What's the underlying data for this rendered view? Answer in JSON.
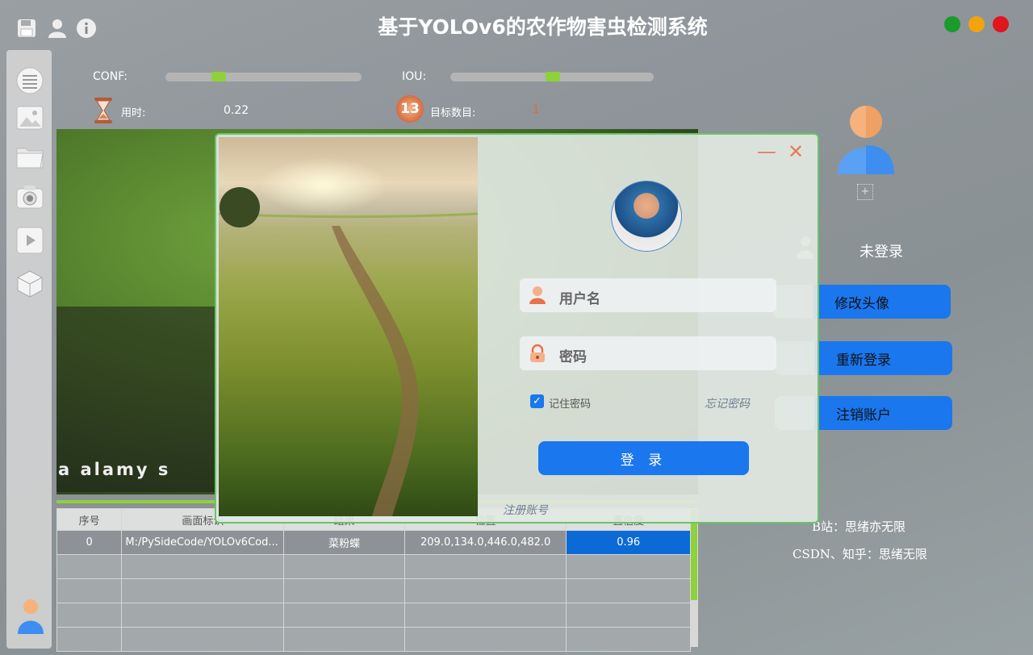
{
  "app": {
    "title": "基于YOLOv6的农作物害虫检测系统",
    "window_controls": [
      "green",
      "yellow",
      "red"
    ]
  },
  "top_icons": [
    "save-icon",
    "user-icon",
    "info-icon"
  ],
  "sidebar": {
    "items": [
      "menu-icon",
      "image-icon",
      "folder-icon",
      "camera-icon",
      "video-icon",
      "model-icon"
    ],
    "bottom": "user-avatar-icon"
  },
  "controls": {
    "conf_label": "CONF:",
    "conf_value": 0.3,
    "iou_label": "IOU:",
    "iou_value": 0.5
  },
  "stats": {
    "time_label": "用时:",
    "time_value": "0.22",
    "count_label": "目标数目:",
    "count_value": "1",
    "count_badge": "13"
  },
  "image": {
    "watermark": "a alamy s"
  },
  "table": {
    "headers": [
      "序号",
      "画面标识",
      "结果",
      "位置",
      "置信度"
    ],
    "rows": [
      [
        "0",
        "M:/PySideCode/YOLOv6Cod...",
        "菜粉蝶",
        "209.0,134.0,446.0,482.0",
        "0.96"
      ],
      [
        "",
        "",
        "",
        "",
        ""
      ],
      [
        "",
        "",
        "",
        "",
        ""
      ],
      [
        "",
        "",
        "",
        "",
        ""
      ],
      [
        "",
        "",
        "",
        "",
        ""
      ]
    ]
  },
  "user_panel": {
    "status": "未登录",
    "add_icon": "+",
    "buttons": [
      "修改头像",
      "重新登录",
      "注销账户"
    ],
    "credits": [
      "B站：思绪亦无限",
      "CSDN、知乎：思绪无限"
    ]
  },
  "login_dialog": {
    "username_placeholder": "用户名",
    "password_placeholder": "密码",
    "remember_label": "记住密码",
    "remember_checked": true,
    "forgot_label": "忘记密码",
    "login_button": "登 录",
    "register_label": "注册账号",
    "minimize_glyph": "—",
    "close_glyph": "✕"
  },
  "colors": {
    "accent_green": "#8ed13a",
    "accent_blue": "#1a77ee",
    "highlight_cell": "#0c6ad7"
  }
}
